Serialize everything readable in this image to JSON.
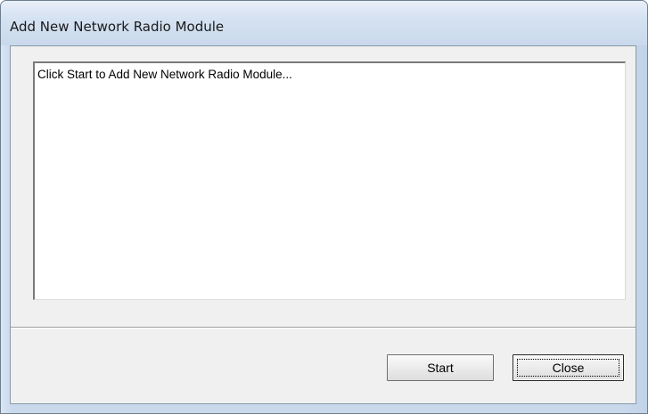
{
  "window": {
    "title": "Add New Network Radio Module"
  },
  "log": {
    "text": "Click Start to Add New Network Radio Module..."
  },
  "buttons": {
    "start_label": "Start",
    "close_label": "Close"
  },
  "colors": {
    "frame": "#c9d9ec",
    "client_background": "#f0f0f0",
    "text_area_background": "#ffffff"
  }
}
